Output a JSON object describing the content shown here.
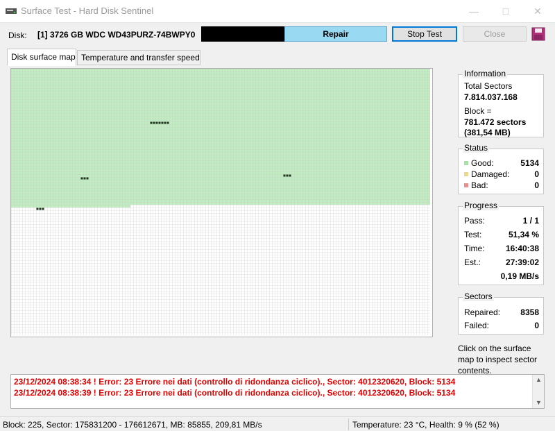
{
  "window": {
    "title": "Surface Test - Hard Disk Sentinel"
  },
  "disk": {
    "label": "Disk:",
    "info": "[1] 3726 GB  WDC WD43PURZ-74BWPY0"
  },
  "toolbar": {
    "repair_label": "Repair",
    "stop_label": "Stop Test",
    "close_label": "Close"
  },
  "tabs": [
    {
      "label": "Disk surface map",
      "active": true
    },
    {
      "label": "Temperature and transfer speed",
      "active": false
    }
  ],
  "information": {
    "title": "Information",
    "total_label": "Total Sectors",
    "total_value": "7.814.037.168",
    "block_label": "Block =",
    "block_sectors": "781.472 sectors",
    "block_size": "(381,54 MB)"
  },
  "status": {
    "title": "Status",
    "items": [
      {
        "label": "Good:",
        "value": "5134",
        "color": "#a8e0a8"
      },
      {
        "label": "Damaged:",
        "value": "0",
        "color": "#e8d890"
      },
      {
        "label": "Bad:",
        "value": "0",
        "color": "#e89090"
      }
    ]
  },
  "progress": {
    "title": "Progress",
    "pass_label": "Pass:",
    "pass_value": "1 / 1",
    "test_label": "Test:",
    "test_value": "51,34 %",
    "time_label": "Time:",
    "time_value": "16:40:38",
    "est_label": "Est.:",
    "est_value": "27:39:02",
    "speed": "0,19 MB/s"
  },
  "sectors": {
    "title": "Sectors",
    "repaired_label": "Repaired:",
    "repaired_value": "8358",
    "failed_label": "Failed:",
    "failed_value": "0"
  },
  "hint": "Click on the surface map to inspect sector contents.",
  "log": [
    "23/12/2024  08:38:34 ! Error: 23 Errore nei dati (controllo di ridondanza ciclico)., Sector: 4012320620, Block: 5134",
    "23/12/2024  08:38:39 ! Error: 23 Errore nei dati (controllo di ridondanza ciclico)., Sector: 4012320620, Block: 5134"
  ],
  "statusbar": {
    "left": "Block: 225, Sector: 175831200 - 176612671, MB: 85855, 209,81 MB/s",
    "right": "Temperature: 23  °C,  Health: 9 % (52 %)"
  },
  "surface_map": {
    "good_color": "#bfeebf",
    "untested_color": "#ffffff",
    "active_block_color": "#1a3a1a",
    "processed_fraction": 0.5134,
    "good_blocks": 5134
  }
}
